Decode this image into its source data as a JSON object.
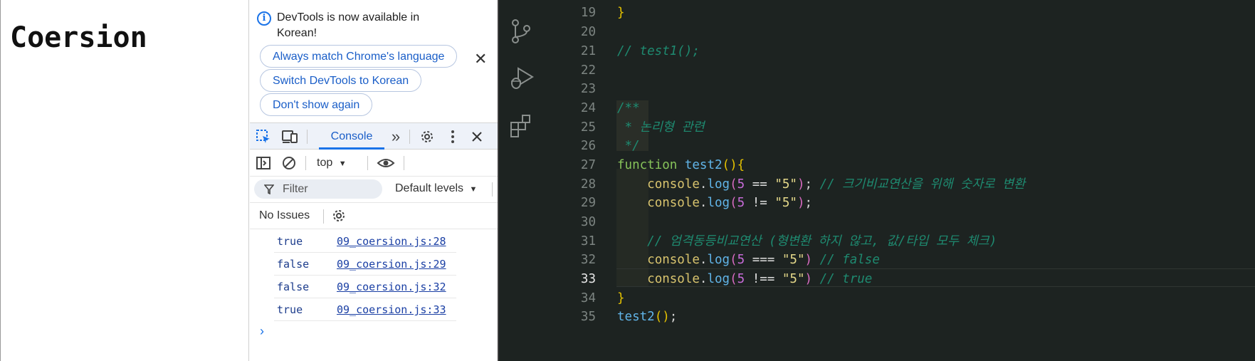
{
  "page": {
    "heading": "Coersion"
  },
  "devtools": {
    "banner": {
      "message": "DevTools is now available in Korean!",
      "buttons": [
        "Always match Chrome's language",
        "Switch DevTools to Korean",
        "Don't show again"
      ],
      "close": "✕"
    },
    "tabs": {
      "console": "Console",
      "more": "»"
    },
    "toolbar": {
      "context": "top",
      "context_arrow": "▼"
    },
    "filter": {
      "placeholder": "Filter",
      "levels": "Default levels",
      "levels_arrow": "▼"
    },
    "issues": {
      "label": "No Issues"
    },
    "logs": [
      {
        "value": "true",
        "source": "09_coersion.js:28"
      },
      {
        "value": "false",
        "source": "09_coersion.js:29"
      },
      {
        "value": "false",
        "source": "09_coersion.js:32"
      },
      {
        "value": "true",
        "source": "09_coersion.js:33"
      }
    ],
    "prompt": "›"
  },
  "editor": {
    "active_line": "33",
    "lines": [
      {
        "n": "19"
      },
      {
        "n": "20"
      },
      {
        "n": "21"
      },
      {
        "n": "22"
      },
      {
        "n": "23"
      },
      {
        "n": "24"
      },
      {
        "n": "25"
      },
      {
        "n": "26"
      },
      {
        "n": "27"
      },
      {
        "n": "28"
      },
      {
        "n": "29"
      },
      {
        "n": "30"
      },
      {
        "n": "31"
      },
      {
        "n": "32"
      },
      {
        "n": "33"
      },
      {
        "n": "34"
      },
      {
        "n": "35"
      }
    ],
    "code": {
      "l19": "}",
      "l21": "// test1();",
      "l24": "/**",
      "l25": " * 논리형 관련",
      "l26": " */",
      "l27_kw": "function",
      "l27_fn": "test2",
      "l28_comment": "// 크기비교연산을 위해 숫자로 변환",
      "l31_comment": "// 엄격동등비교연산 (형변환 하지 않고, 값/타입 모두 체크)",
      "l32_comment": "// false",
      "l33_comment": "// true",
      "l35_fn": "test2",
      "obj": "console",
      "method": "log",
      "num": "5",
      "str": "\"5\"",
      "op_eq": "==",
      "op_neq": "!=",
      "op_seq": "===",
      "op_sneq": "!=="
    }
  }
}
